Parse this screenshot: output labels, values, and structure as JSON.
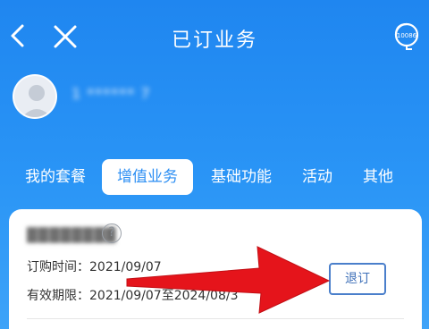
{
  "header": {
    "title": "已订业务",
    "back_icon": "chevron-left-icon",
    "close_icon": "close-icon",
    "service_icon": "customer-service-10086-icon",
    "service_label": "10086"
  },
  "profile": {
    "avatar": "default-user-avatar",
    "name": "1 ****** 7"
  },
  "tabs": [
    {
      "label": "我的套餐",
      "active": false
    },
    {
      "label": "增值业务",
      "active": true
    },
    {
      "label": "基础功能",
      "active": false
    },
    {
      "label": "活动",
      "active": false
    },
    {
      "label": "其他",
      "active": false
    }
  ],
  "subscription": {
    "product_name": "████████",
    "order_time_label": "订购时间：",
    "order_time_value": "2021/09/07",
    "validity_label": "有效期限：",
    "validity_value": "2021/09/07至2024/08/3",
    "action_label": "退订"
  },
  "colors": {
    "header_bg": "#2a95f6",
    "active_tab_text": "#2b8ef3",
    "arrow": "#e5141b"
  }
}
